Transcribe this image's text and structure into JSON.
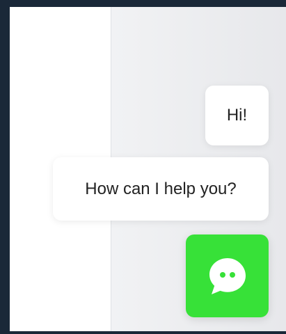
{
  "chat": {
    "greeting": "Hi!",
    "question": "How can I help you?"
  },
  "icons": {
    "chat_button": "chat-bubble-icon"
  },
  "colors": {
    "accent": "#37e138",
    "bubble": "#ffffff",
    "background": "#e9eaed",
    "frame": "#1a2838"
  }
}
